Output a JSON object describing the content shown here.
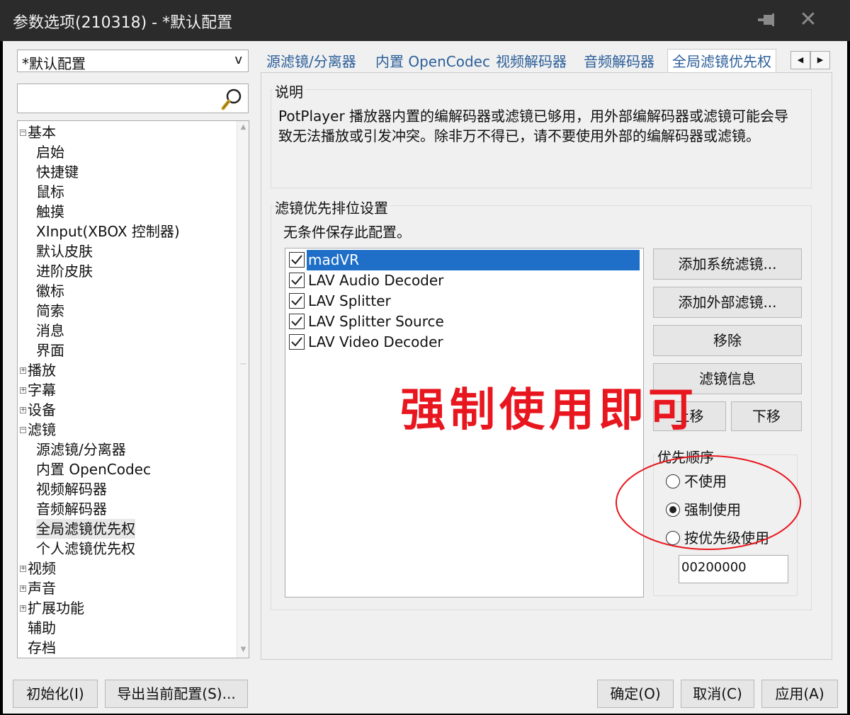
{
  "window": {
    "title": "参数选项(210318) - *默认配置",
    "pin_icon": "pin-icon",
    "close_icon": "close-icon",
    "close_glyph": "✕"
  },
  "sidebar": {
    "profile": {
      "value": "*默认配置",
      "arrow": "v"
    },
    "search": {
      "value": "",
      "icon": "search-icon"
    },
    "tree": [
      {
        "label": "基本",
        "level": 0,
        "expander": "−"
      },
      {
        "label": "启始",
        "level": 1
      },
      {
        "label": "快捷键",
        "level": 1
      },
      {
        "label": "鼠标",
        "level": 1
      },
      {
        "label": "触摸",
        "level": 1
      },
      {
        "label": "XInput(XBOX 控制器)",
        "level": 1
      },
      {
        "label": "默认皮肤",
        "level": 1
      },
      {
        "label": "进阶皮肤",
        "level": 1
      },
      {
        "label": "徽标",
        "level": 1
      },
      {
        "label": "简索",
        "level": 1
      },
      {
        "label": "消息",
        "level": 1
      },
      {
        "label": "界面",
        "level": 1
      },
      {
        "label": "播放",
        "level": 0,
        "expander": "+"
      },
      {
        "label": "字幕",
        "level": 0,
        "expander": "+"
      },
      {
        "label": "设备",
        "level": 0,
        "expander": "+"
      },
      {
        "label": "滤镜",
        "level": 0,
        "expander": "−"
      },
      {
        "label": "源滤镜/分离器",
        "level": 1
      },
      {
        "label": "内置 OpenCodec",
        "level": 1
      },
      {
        "label": "视频解码器",
        "level": 1
      },
      {
        "label": "音频解码器",
        "level": 1
      },
      {
        "label": "全局滤镜优先权",
        "level": 1,
        "selected": true
      },
      {
        "label": "个人滤镜优先权",
        "level": 1
      },
      {
        "label": "视频",
        "level": 0,
        "expander": "+"
      },
      {
        "label": "声音",
        "level": 0,
        "expander": "+"
      },
      {
        "label": "扩展功能",
        "level": 0,
        "expander": "+"
      },
      {
        "label": "辅助",
        "level": 0
      },
      {
        "label": "存档",
        "level": 0
      }
    ]
  },
  "tabs": [
    {
      "label": "源滤镜/分离器"
    },
    {
      "label": "内置 OpenCodec"
    },
    {
      "label": "视频解码器"
    },
    {
      "label": "音频解码器"
    },
    {
      "label": "全局滤镜优先权",
      "active": true
    }
  ],
  "description": {
    "heading": "说明",
    "text": "PotPlayer 播放器内置的编解码器或滤镜已够用，用外部编解码器或滤镜可能会导致无法播放或引发冲突。除非万不得已，请不要使用外部的编解码器或滤镜。"
  },
  "priority": {
    "heading": "滤镜优先排位设置",
    "note": "无条件保存此配置。",
    "filters": [
      {
        "name": "madVR",
        "checked": true,
        "selected": true
      },
      {
        "name": "LAV Audio Decoder",
        "checked": true
      },
      {
        "name": "LAV Splitter",
        "checked": true
      },
      {
        "name": "LAV Splitter Source",
        "checked": true
      },
      {
        "name": "LAV Video Decoder",
        "checked": true
      }
    ],
    "buttons": {
      "add_system": "添加系统滤镜...",
      "add_external": "添加外部滤镜...",
      "remove": "移除",
      "info": "滤镜信息",
      "up": "上移",
      "down": "下移"
    },
    "order": {
      "heading": "优先顺序",
      "options": [
        {
          "label": "不使用",
          "checked": false
        },
        {
          "label": "强制使用",
          "checked": true
        },
        {
          "label": "按优先级使用",
          "checked": false
        }
      ],
      "value": "00200000"
    }
  },
  "footer": {
    "reset": "初始化(I)",
    "export": "导出当前配置(S)...",
    "ok": "确定(O)",
    "cancel": "取消(C)",
    "apply": "应用(A)"
  },
  "annotation": {
    "text": "强制使用即可",
    "color": "#e8161e"
  }
}
